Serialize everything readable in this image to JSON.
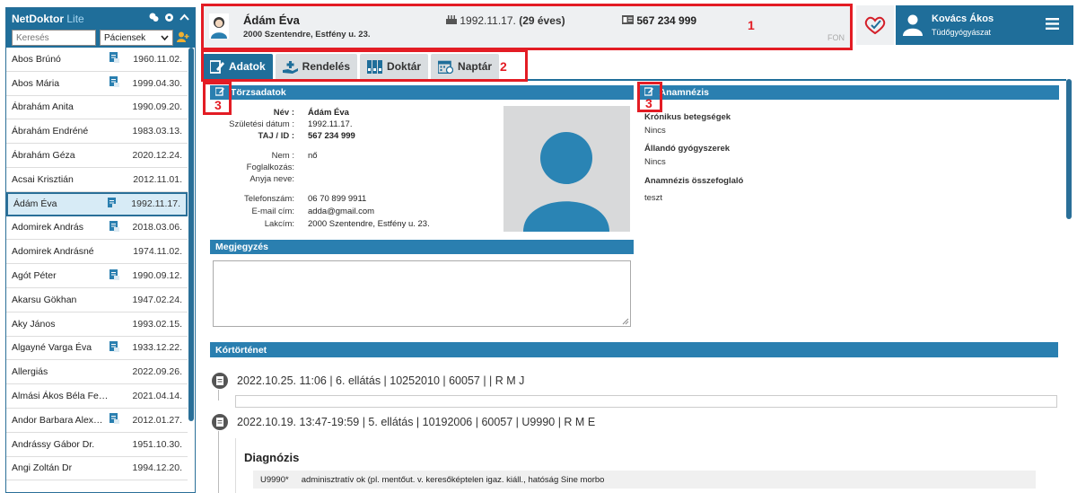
{
  "sidebar": {
    "app_name": "NetDoktor",
    "app_suffix": "Lite",
    "search_placeholder": "Keresés",
    "filter_selected": "Páciensek",
    "patients": [
      {
        "name": "Abos Brúnó",
        "date": "1960.11.02.",
        "doc": true
      },
      {
        "name": "Abos Mária",
        "date": "1999.04.30.",
        "doc": true
      },
      {
        "name": "Ábrahám Anita",
        "date": "1990.09.20.",
        "doc": false
      },
      {
        "name": "Ábrahám Endréné",
        "date": "1983.03.13.",
        "doc": false
      },
      {
        "name": "Ábrahám Géza",
        "date": "2020.12.24.",
        "doc": false
      },
      {
        "name": "Acsai Krisztián",
        "date": "2012.11.01.",
        "doc": false
      },
      {
        "name": "Ádám Éva",
        "date": "1992.11.17.",
        "doc": true,
        "selected": true
      },
      {
        "name": "Adomirek András",
        "date": "2018.03.06.",
        "doc": true
      },
      {
        "name": "Adomirek Andrásné",
        "date": "1974.11.02.",
        "doc": false
      },
      {
        "name": "Agót Péter",
        "date": "1990.09.12.",
        "doc": true
      },
      {
        "name": "Akarsu Gökhan",
        "date": "1947.02.24.",
        "doc": false
      },
      {
        "name": "Aky János",
        "date": "1993.02.15.",
        "doc": false
      },
      {
        "name": "Algayné Varga Éva",
        "date": "1933.12.22.",
        "doc": true
      },
      {
        "name": "Allergiás",
        "date": "2022.09.26.",
        "doc": false
      },
      {
        "name": "Almási Ákos Béla Ferenc",
        "date": "2021.04.14.",
        "doc": false
      },
      {
        "name": "Andor Barbara Alex…",
        "date": "2012.01.27.",
        "doc": true
      },
      {
        "name": "Andrássy Gábor Dr.",
        "date": "1951.10.30.",
        "doc": false
      },
      {
        "name": "Angi Zoltán Dr",
        "date": "1994.12.20.",
        "doc": false
      }
    ]
  },
  "header": {
    "patient_name": "Ádám Éva",
    "address": "2000 Szentendre, Estfény u. 23.",
    "birth_date": "1992.11.17.",
    "age": "(29 éves)",
    "taj": "567 234 999",
    "fon": "FON"
  },
  "user": {
    "name": "Kovács Ákos",
    "specialty": "Tüdőgyógyászat"
  },
  "tabs": [
    {
      "label": "Adatok",
      "active": true
    },
    {
      "label": "Rendelés",
      "active": false
    },
    {
      "label": "Doktár",
      "active": false
    },
    {
      "label": "Naptár",
      "active": false
    }
  ],
  "annotations": {
    "n1": "1",
    "n2": "2",
    "n3a": "3",
    "n3b": "3"
  },
  "torzsadatok": {
    "title": "Törzsadatok",
    "name_label": "Név :",
    "name_value": "Ádám Éva",
    "birth_label": "Születési dátum :",
    "birth_value": "1992.11.17.",
    "taj_label": "TAJ / ID :",
    "taj_value": "567 234 999",
    "sex_label": "Nem :",
    "sex_value": "nő",
    "job_label": "Foglalkozás:",
    "mother_label": "Anyja neve:",
    "phone_label": "Telefonszám:",
    "phone_value": "06 70 899 9911",
    "email_label": "E-mail cím:",
    "email_value": "adda@gmail.com",
    "address_label": "Lakcím:",
    "address_value": "2000 Szentendre, Estfény u. 23."
  },
  "anamnezis": {
    "title": "Anamnézis",
    "chronic_label": "Krónikus betegségek",
    "chronic_value": "Nincs",
    "drugs_label": "Állandó gyógyszerek",
    "drugs_value": "Nincs",
    "summary_label": "Anamnézis összefoglaló",
    "summary_value": "teszt"
  },
  "megjegyzes": {
    "title": "Megjegyzés"
  },
  "kortortenet": {
    "title": "Kórtörténet",
    "entries": [
      "2022.10.25. 11:06 | 6. ellátás | 10252010 | 60057 | | R M J",
      "2022.10.19. 13:47-19:59 | 5. ellátás | 10192006 | 60057 | U9990 | R M E"
    ],
    "diagnosis_title": "Diagnózis",
    "diagnosis_code": "U9990*",
    "diagnosis_text": "adminisztratív ok (pl. mentőut. v. keresőképtelen igaz. kiáll., hatóság Sine morbo"
  },
  "colors": {
    "primary": "#1f6e9a",
    "panel": "#2a7fb0",
    "annotation": "#e31c24"
  }
}
